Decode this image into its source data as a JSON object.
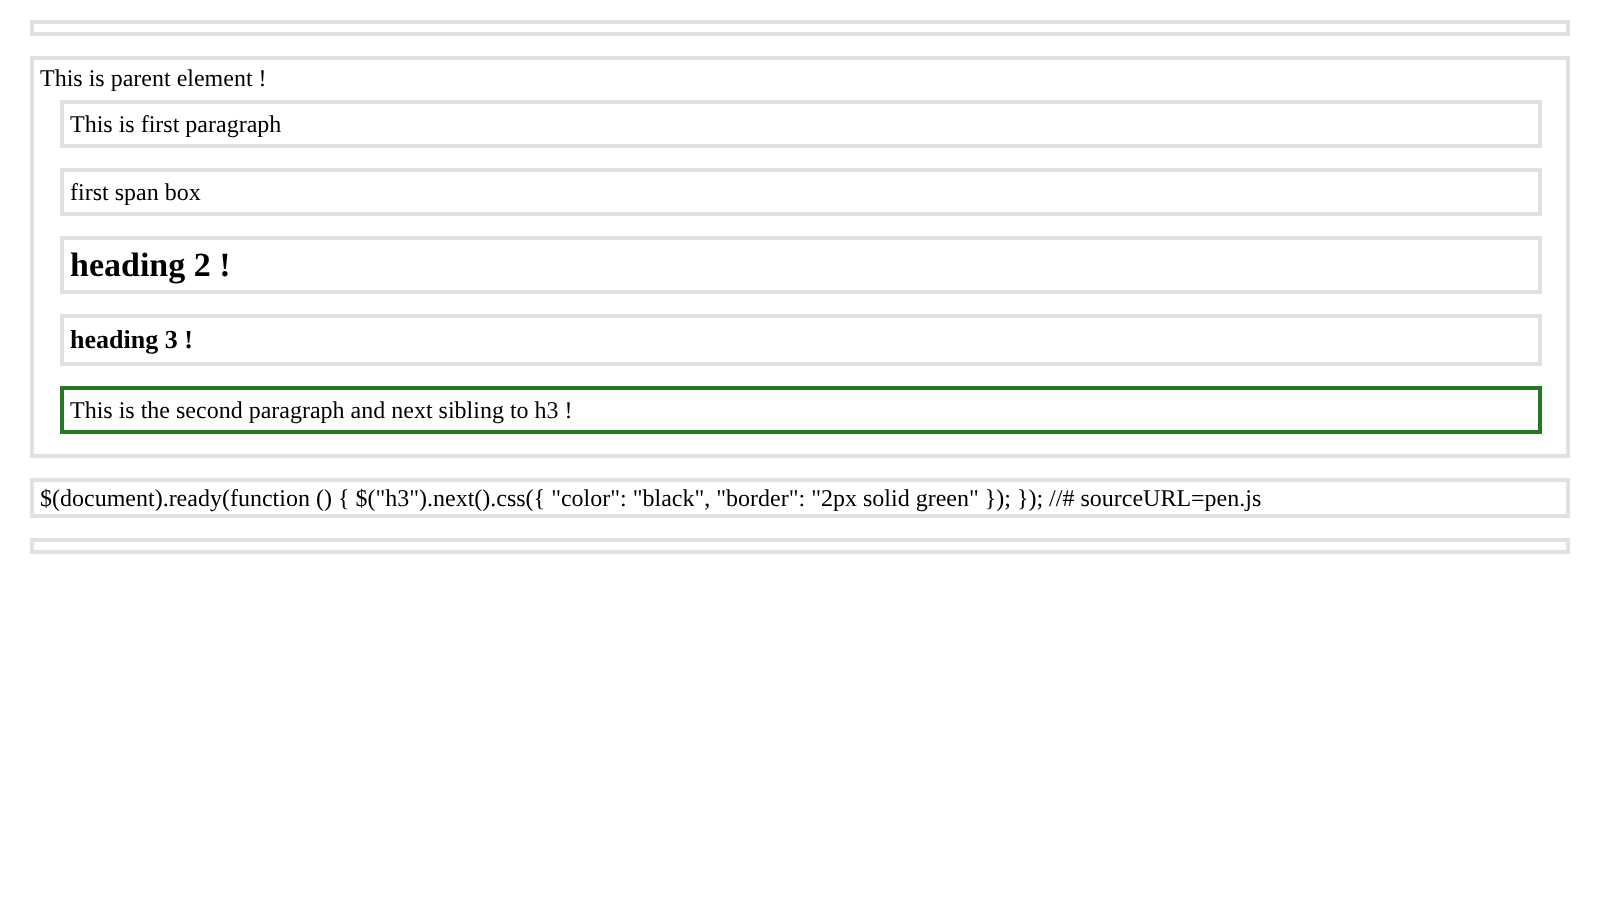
{
  "parent": {
    "label": "This is parent element !",
    "children": [
      {
        "kind": "paragraph",
        "text": "This is first paragraph",
        "highlighted": false
      },
      {
        "kind": "span",
        "text": "first span box",
        "highlighted": false
      },
      {
        "kind": "h2",
        "text": "heading 2 !",
        "highlighted": false
      },
      {
        "kind": "h3",
        "text": "heading 3 !",
        "highlighted": false
      },
      {
        "kind": "paragraph",
        "text": "This is the second paragraph and next sibling to h3 !",
        "highlighted": true
      }
    ]
  },
  "code": "$(document).ready(function () { $(\"h3\").next().css({ \"color\": \"black\", \"border\": \"2px solid green\" }); }); //# sourceURL=pen.js"
}
